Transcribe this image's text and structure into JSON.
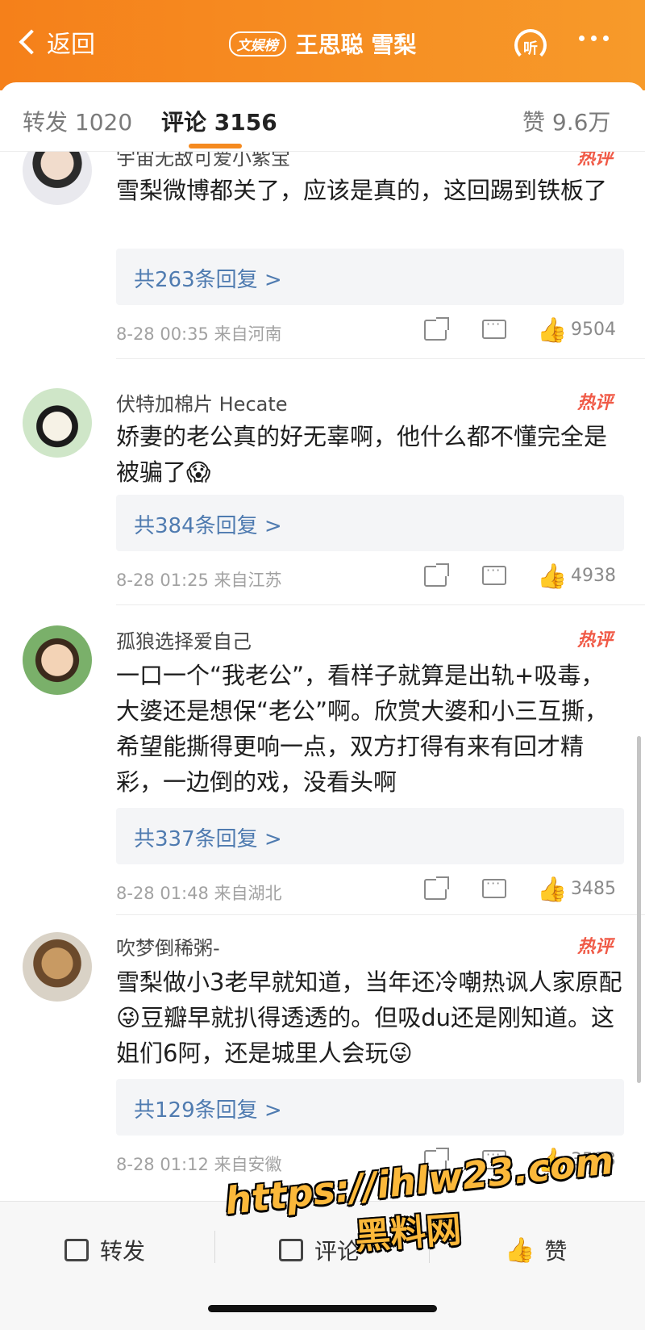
{
  "header": {
    "back_label": "返回",
    "badge": "文娱榜",
    "title": "王思聪 雪梨",
    "listen_label": "听"
  },
  "tabs": {
    "repost": "转发 1020",
    "comment": "评论 3156",
    "like": "赞 9.6万"
  },
  "comments": [
    {
      "user": "宇宙无敌可爱小紫宝",
      "badge": "热评",
      "text": "雪梨微博都关了，应该是真的，这回踢到铁板了",
      "replies": "共263条回复 >",
      "meta": "8-28 00:35  来自河南",
      "likes": "9504"
    },
    {
      "user": "伏特加棉片 Hecate",
      "badge": "热评",
      "text": "娇妻的老公真的好无辜啊，他什么都不懂完全是被骗了😱",
      "replies": "共384条回复 >",
      "meta": "8-28 01:25  来自江苏",
      "likes": "4938"
    },
    {
      "user": "孤狼选择爱自己",
      "badge": "热评",
      "text": "一口一个“我老公”，看样子就算是出轨+吸毒，大婆还是想保“老公”啊。欣赏大婆和小三互撕，希望能撕得更响一点，双方打得有来有回才精彩，一边倒的戏，没看头啊",
      "replies": "共337条回复 >",
      "meta": "8-28 01:48  来自湖北",
      "likes": "3485"
    },
    {
      "user": "吹梦倒稀粥-",
      "badge": "热评",
      "text": "雪梨做小3老早就知道，当年还冷嘲热讽人家原配😜豆瓣早就扒得透透的。但吸du还是刚知道。这姐们6阿，还是城里人会玩😜",
      "replies": "共129条回复 >",
      "meta": "8-28 01:12  来自安徽",
      "likes": "3593"
    }
  ],
  "bottom_bar": {
    "repost": "转发",
    "comment": "评论",
    "like": "赞"
  },
  "watermark": {
    "url": "https://ihlw23.com",
    "name": "黑料网"
  },
  "colors": {
    "header_orange": "#f5801a",
    "reply_link": "#4f7bb0",
    "hot_badge": "#f05a47"
  }
}
